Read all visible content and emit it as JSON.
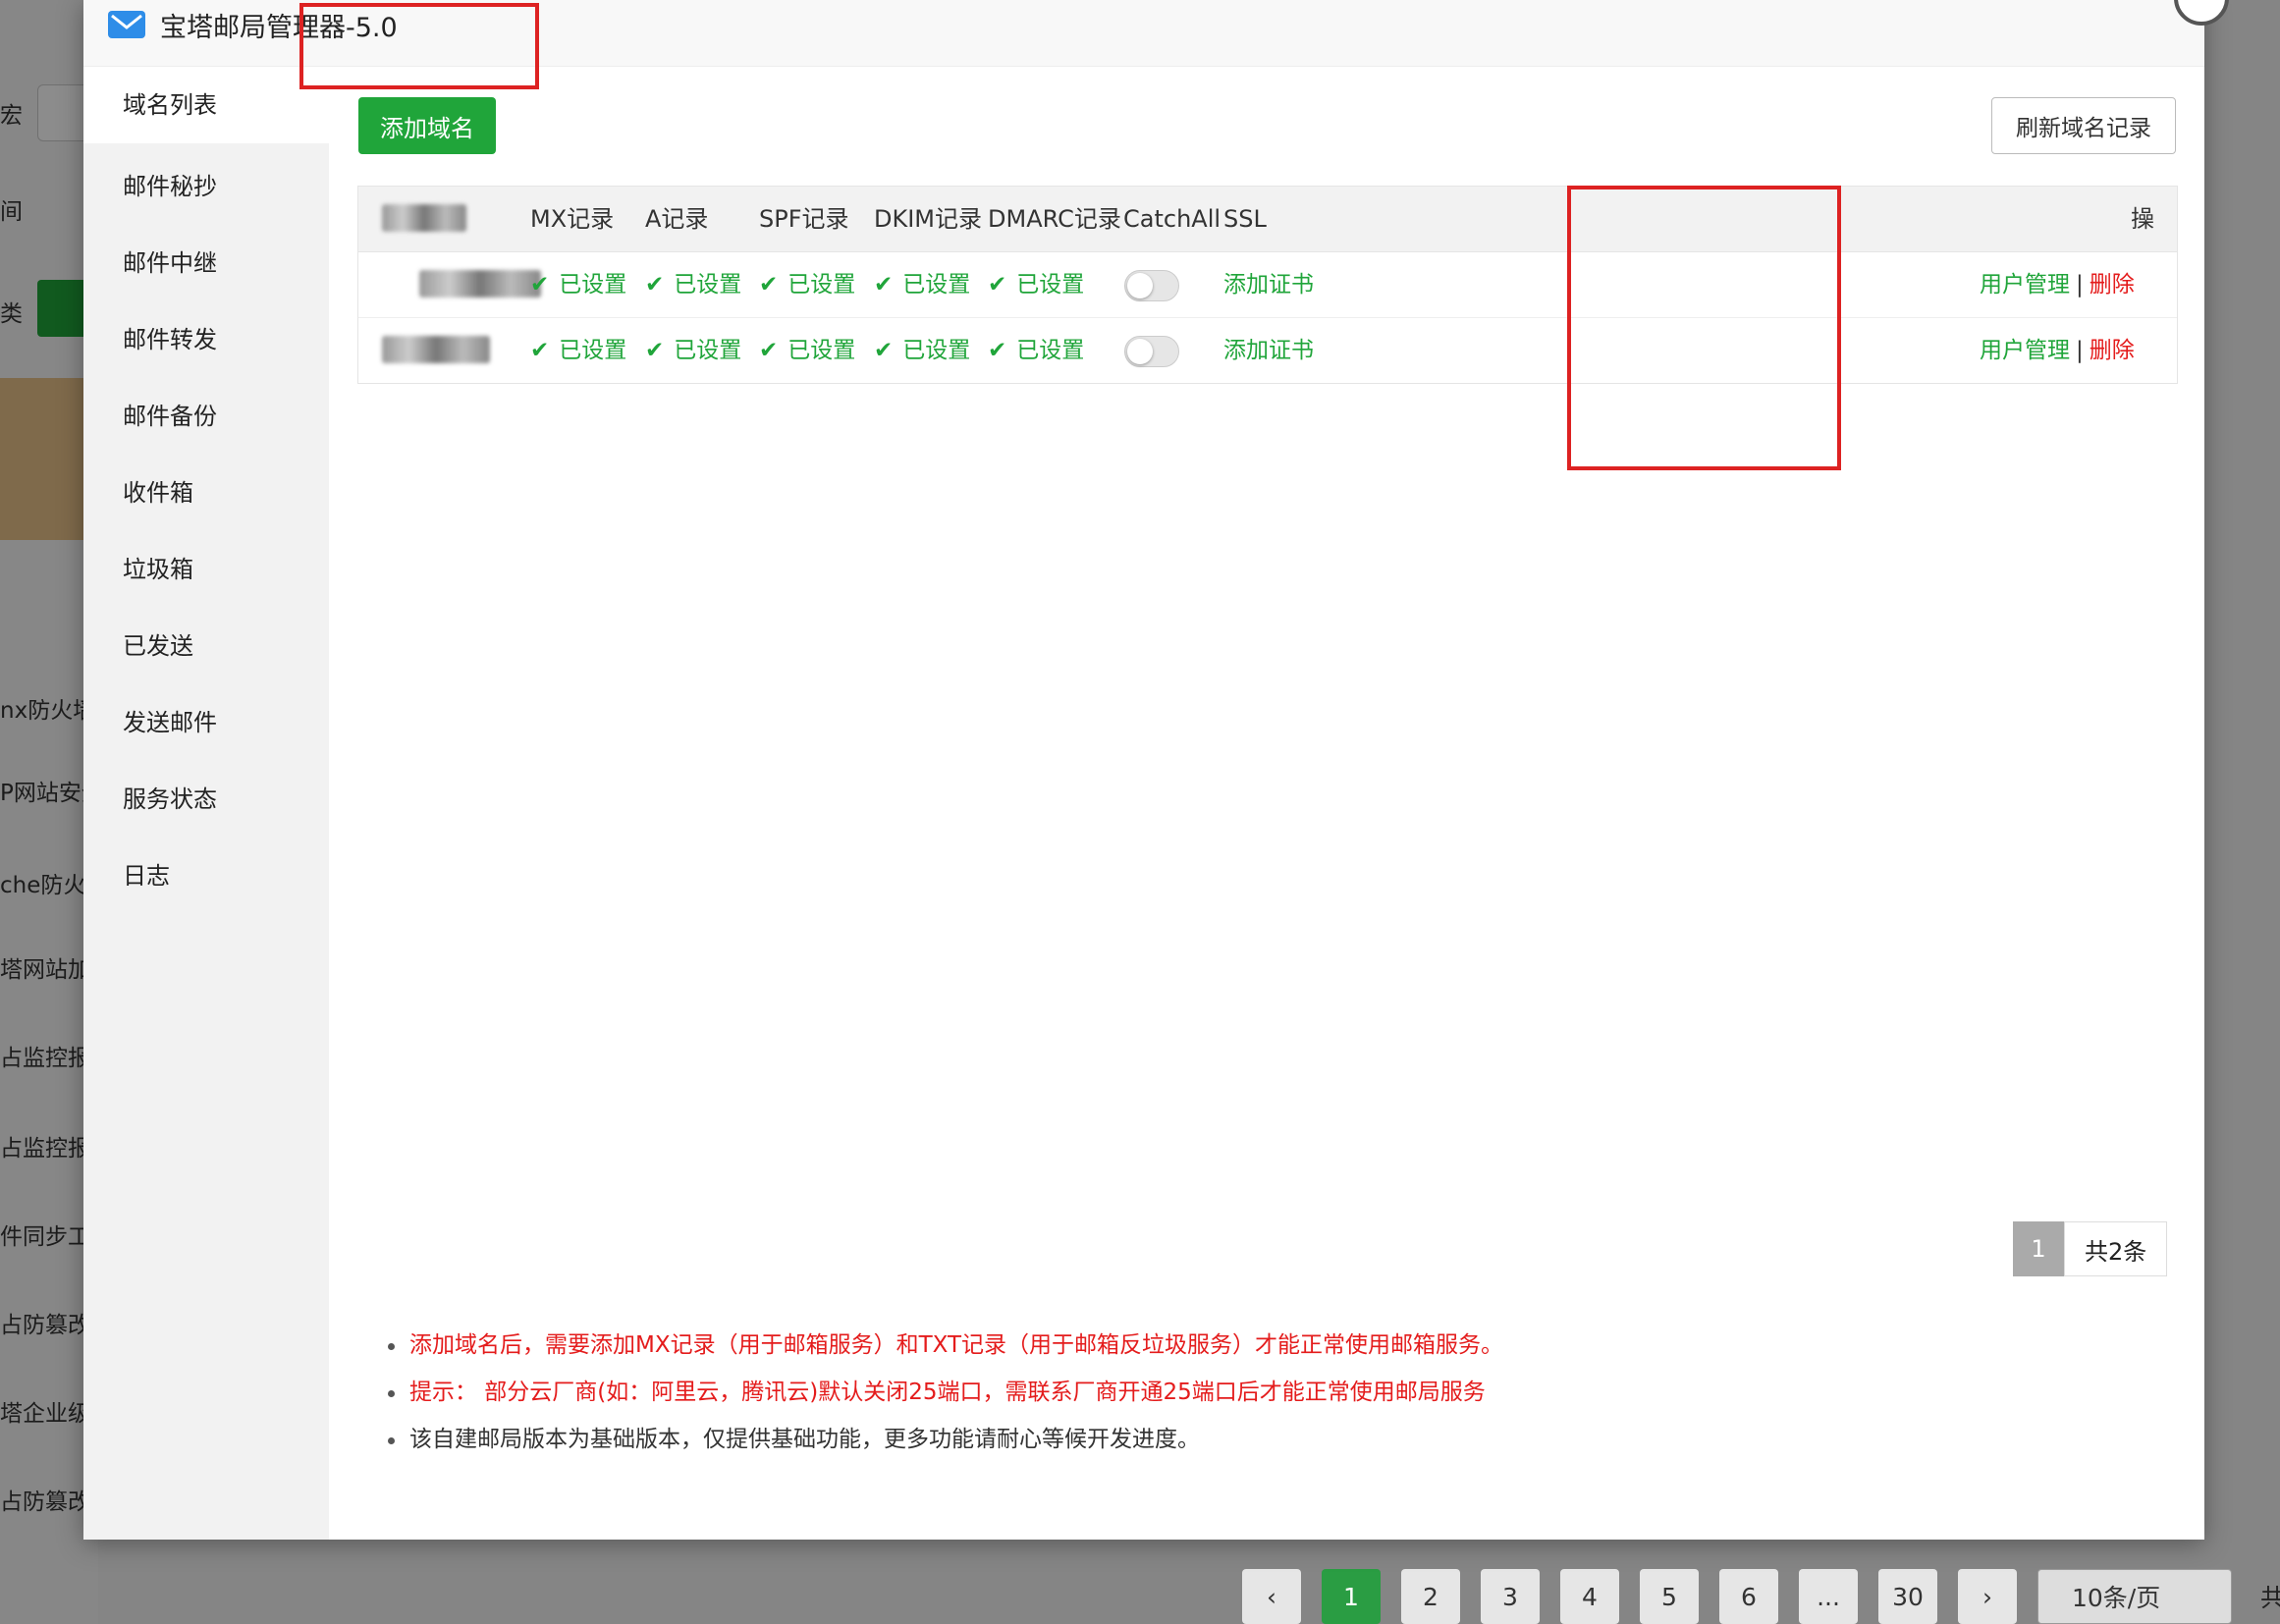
{
  "window": {
    "title": "宝塔邮局管理器-5.0"
  },
  "sidebar": {
    "items": [
      {
        "label": "域名列表"
      },
      {
        "label": "邮件秘抄"
      },
      {
        "label": "邮件中继"
      },
      {
        "label": "邮件转发"
      },
      {
        "label": "邮件备份"
      },
      {
        "label": "收件箱"
      },
      {
        "label": "垃圾箱"
      },
      {
        "label": "已发送"
      },
      {
        "label": "发送邮件"
      },
      {
        "label": "服务状态"
      },
      {
        "label": "日志"
      }
    ]
  },
  "toolbar": {
    "add_domain_label": "添加域名",
    "refresh_label": "刷新域名记录"
  },
  "table": {
    "headers": [
      "MX记录",
      "A记录",
      "SPF记录",
      "DKIM记录",
      "DMARC记录",
      "CatchAll",
      "SSL",
      "操作"
    ],
    "rows": [
      {
        "mx": "已设置",
        "a": "已设置",
        "spf": "已设置",
        "dkim": "已设置",
        "dmarc": "已设置",
        "ssl": "添加证书",
        "manage": "用户管理",
        "delete": "删除"
      },
      {
        "mx": "已设置",
        "a": "已设置",
        "spf": "已设置",
        "dkim": "已设置",
        "dmarc": "已设置",
        "ssl": "添加证书",
        "manage": "用户管理",
        "delete": "删除"
      }
    ],
    "separator": "|"
  },
  "pager": {
    "current": "1",
    "total": "共2条"
  },
  "notes": [
    "添加域名后，需要添加MX记录（用于邮箱服务）和TXT记录（用于邮箱反垃圾服务）才能正常使用邮箱服务。",
    "提示： 部分云厂商(如：阿里云，腾讯云)默认关闭25端口，需联系厂商开通25端口后才能正常使用邮局服务",
    "该自建邮局版本为基础版本，仅提供基础功能，更多功能请耐心等候开发进度。"
  ],
  "background": {
    "left_items": [
      "宏",
      "间",
      "类",
      "nx防火墙",
      "P网站安全",
      "che防火墙",
      "塔网站加速",
      "占监控报表",
      "占监控报表",
      "件同步工具",
      "占防篡改程序",
      "塔企业级防篡改",
      "占防篡改程序"
    ],
    "pagination": [
      "1",
      "2",
      "3",
      "4",
      "5",
      "6",
      "...",
      "30"
    ],
    "page_size": "10条/页",
    "total_tail": "共"
  },
  "colors": {
    "brand_green": "#20a53a",
    "danger_red": "#e41c1c",
    "annotation_red": "#dd2222"
  }
}
